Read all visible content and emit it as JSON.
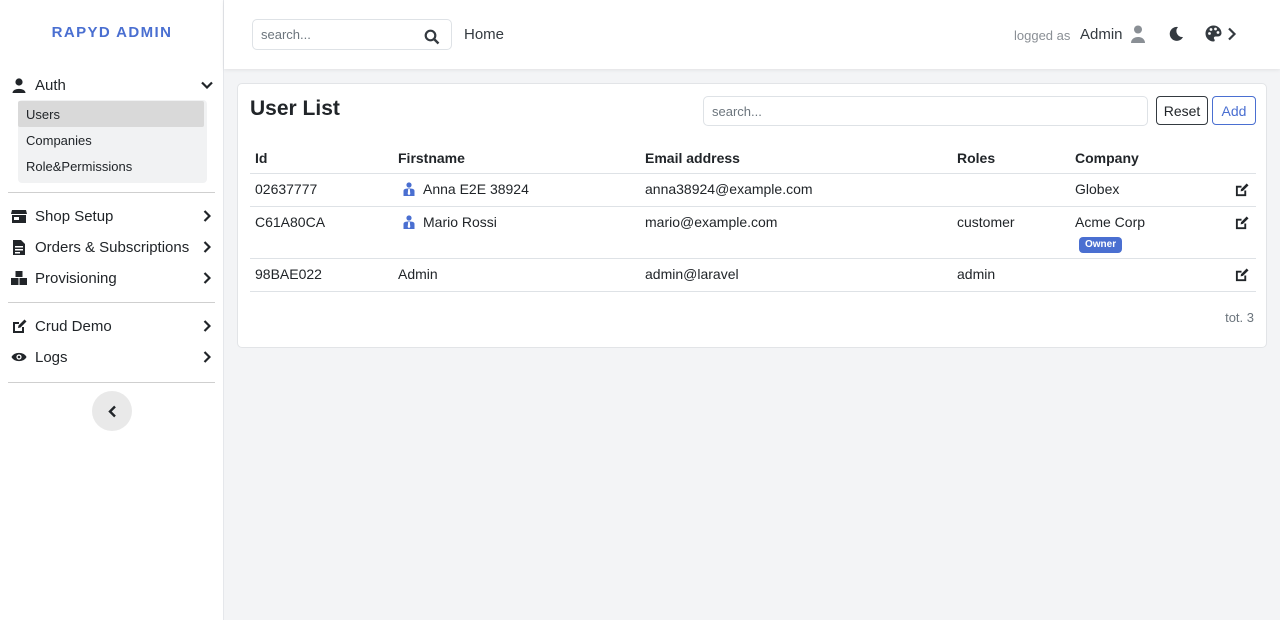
{
  "brand": "RAPYD ADMIN",
  "sidebar": {
    "auth_label": "Auth",
    "auth_items": [
      "Users",
      "Companies",
      "Role&Permissions"
    ],
    "active_item": "Users",
    "groups": [
      {
        "label": "Shop Setup",
        "icon": "store-icon"
      },
      {
        "label": "Orders & Subscriptions",
        "icon": "file-invoice-icon"
      },
      {
        "label": "Provisioning",
        "icon": "cubes-icon"
      },
      {
        "label": "Crud Demo",
        "icon": "edit-icon"
      },
      {
        "label": "Logs",
        "icon": "eye-icon"
      }
    ]
  },
  "topbar": {
    "search_placeholder": "search...",
    "home_label": "Home",
    "logged_as_label": "logged as",
    "user_name": "Admin"
  },
  "card": {
    "title": "User List",
    "search_placeholder": "search...",
    "reset_label": "Reset",
    "add_label": "Add",
    "columns": [
      "Id",
      "Firstname",
      "Email address",
      "Roles",
      "Company"
    ],
    "rows": [
      {
        "id": "02637777",
        "firstname": "Anna E2E 38924",
        "email": "anna38924@example.com",
        "roles": "",
        "company": "Globex",
        "icon": "user-tie-icon"
      },
      {
        "id": "C61A80CA",
        "firstname": "Mario Rossi",
        "email": "mario@example.com",
        "roles": "customer",
        "company": "Acme Corp",
        "badge": "Owner",
        "icon": "user-tie-icon"
      },
      {
        "id": "98BAE022",
        "firstname": "Admin",
        "email": "admin@laravel",
        "roles": "admin",
        "company": ""
      }
    ],
    "total": "tot. 3"
  },
  "colors": {
    "accent": "#4a6fd1",
    "background": "#f3f4f6",
    "active_item": "#d9d9d9"
  }
}
